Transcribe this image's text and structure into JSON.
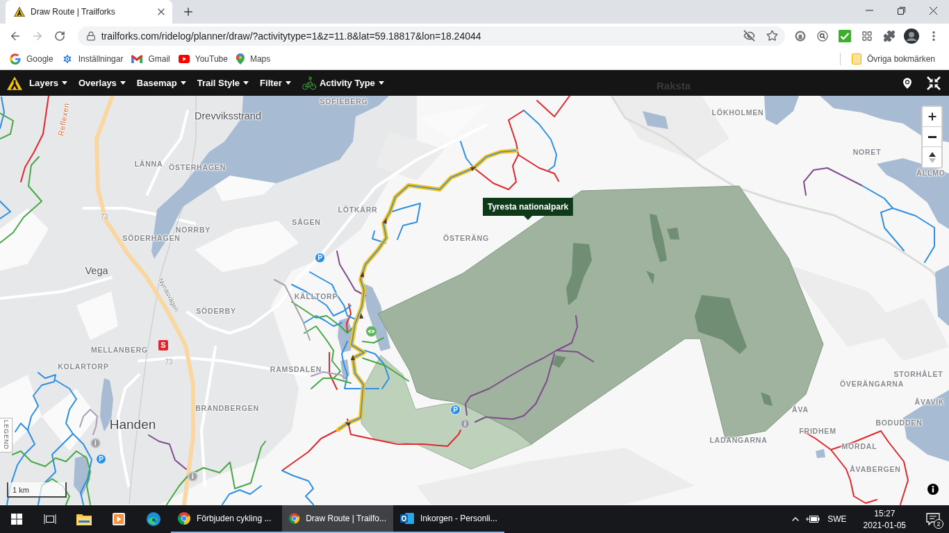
{
  "browser": {
    "tabs": [
      {
        "title": "Draw Route | Trailforks",
        "selected": true
      }
    ],
    "url": "trailforks.com/ridelog/planner/draw/?activitytype=1&z=11.8&lat=59.18817&lon=18.24044",
    "bookmarks": [
      {
        "label": "Google",
        "kind": "google"
      },
      {
        "label": "Inställningar",
        "kind": "settings"
      },
      {
        "label": "Gmail",
        "kind": "gmail"
      },
      {
        "label": "YouTube",
        "kind": "youtube"
      },
      {
        "label": "Maps",
        "kind": "maps"
      }
    ],
    "other_bookmarks": "Övriga bokmärken"
  },
  "toolbar": {
    "menus": [
      {
        "label": "Layers",
        "kind": "menu"
      },
      {
        "label": "Overlays",
        "kind": "menu"
      },
      {
        "label": "Basemap",
        "kind": "menu"
      },
      {
        "label": "Trail Style",
        "kind": "menu"
      },
      {
        "label": "Filter",
        "kind": "menu"
      },
      {
        "label": "Activity Type",
        "kind": "activity"
      }
    ],
    "map_label": "Raksta"
  },
  "map": {
    "labels": [
      {
        "text": "SOFIEBERG",
        "kind": "district"
      },
      {
        "text": "LÖKHOLMEN",
        "kind": "district"
      },
      {
        "text": "Reflexen",
        "kind": "trail_name"
      },
      {
        "text": "Drevviksstrand",
        "kind": "town"
      },
      {
        "text": "NORET",
        "kind": "district"
      },
      {
        "text": "LÄNNA",
        "kind": "district"
      },
      {
        "text": "ÖSTERHAGEN",
        "kind": "district"
      },
      {
        "text": "ÄLLMO",
        "kind": "district"
      },
      {
        "text": "LÖTKÄRR",
        "kind": "district"
      },
      {
        "text": "73",
        "kind": "road_number"
      },
      {
        "text": "SÅGEN",
        "kind": "district"
      },
      {
        "text": "NORRBY",
        "kind": "district"
      },
      {
        "text": "SÖDERHAGEN",
        "kind": "district"
      },
      {
        "text": "ÖSTERÄNG",
        "kind": "district"
      },
      {
        "text": "Vega",
        "kind": "town"
      },
      {
        "text": "Nynäsvägen",
        "kind": "street"
      },
      {
        "text": "KÄLLTORP",
        "kind": "district"
      },
      {
        "text": "SÖDERBY",
        "kind": "district"
      },
      {
        "text": "MELLANBERG",
        "kind": "district"
      },
      {
        "text": "73",
        "kind": "road_number"
      },
      {
        "text": "KOLARTORP",
        "kind": "district"
      },
      {
        "text": "RAMSDALEN",
        "kind": "district"
      },
      {
        "text": "STORHÅLET",
        "kind": "district"
      },
      {
        "text": "ÖVERÄNGARNA",
        "kind": "district"
      },
      {
        "text": "ÅVAVIK",
        "kind": "district"
      },
      {
        "text": "BRANDBERGEN",
        "kind": "district"
      },
      {
        "text": "ÅVA",
        "kind": "district"
      },
      {
        "text": "BODUDDEN",
        "kind": "district"
      },
      {
        "text": "Handen",
        "kind": "city"
      },
      {
        "text": "FRIDHEM",
        "kind": "district"
      },
      {
        "text": "LADANGARNA",
        "kind": "district"
      },
      {
        "text": "MORDAL",
        "kind": "district"
      },
      {
        "text": "ÅVABERGEN",
        "kind": "district"
      }
    ],
    "markers": [
      {
        "kind": "parking",
        "label": "P"
      },
      {
        "kind": "viewpoint"
      },
      {
        "kind": "shop",
        "label": "S"
      },
      {
        "kind": "parking",
        "label": "P"
      },
      {
        "kind": "info",
        "label": "i"
      },
      {
        "kind": "info",
        "label": "i"
      },
      {
        "kind": "parking",
        "label": "P"
      },
      {
        "kind": "info",
        "label": "i"
      }
    ],
    "tooltip": "Tyresta nationalpark",
    "legend_tab": "LEGEND",
    "scale": "1 km"
  },
  "taskbar": {
    "windows": [
      {
        "label": "Förbjuden cykling ...",
        "kind": "browser",
        "selected": false
      },
      {
        "label": "Draw Route | Trailfo...",
        "kind": "browser",
        "selected": true
      },
      {
        "label": "Inkorgen - Personli...",
        "kind": "mail",
        "selected": false
      }
    ],
    "language": "SWE",
    "time": "15:27",
    "date": "2021-01-05",
    "notifications": "2"
  }
}
